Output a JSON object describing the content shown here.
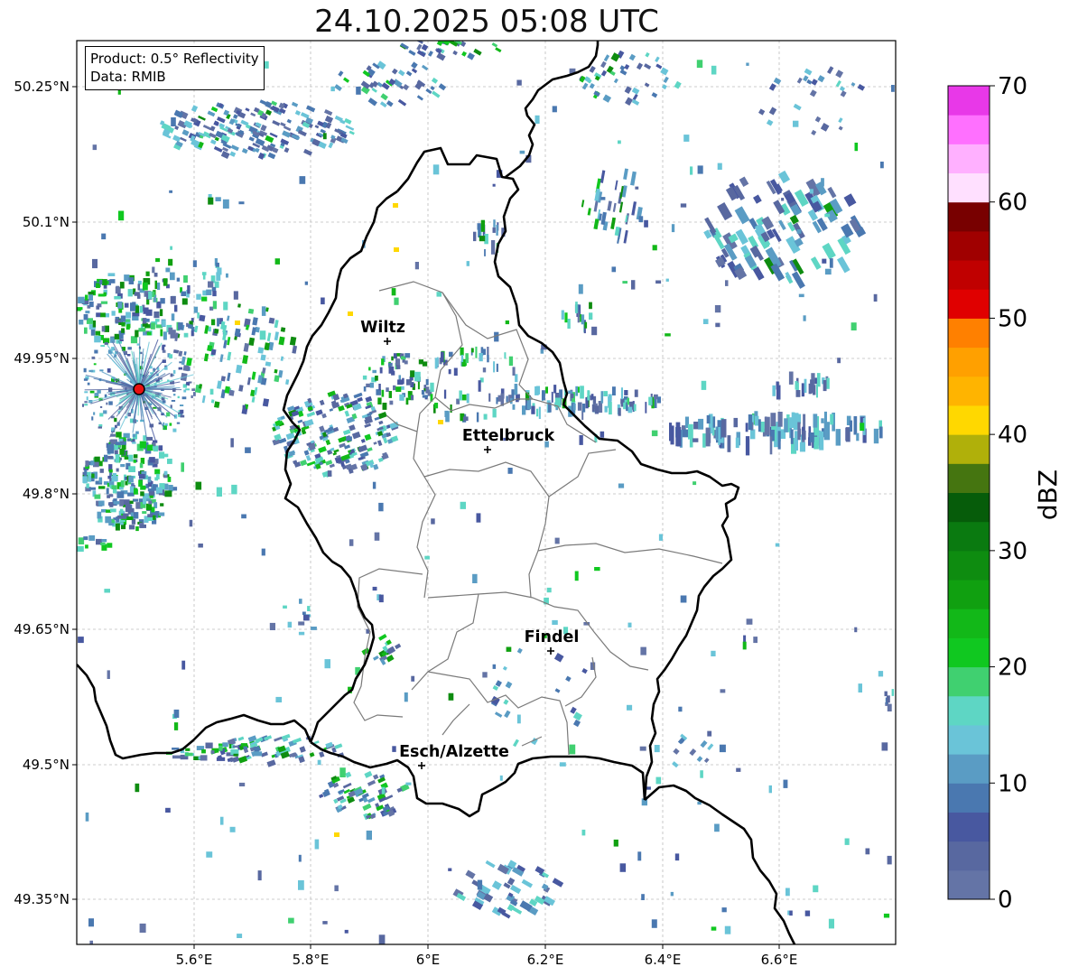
{
  "title": "24.10.2025 05:08 UTC",
  "info": {
    "product": "Product: 0.5° Reflectivity",
    "data": "Data: RMIB"
  },
  "axes": {
    "lon_ticks": [
      "5.6°E",
      "5.8°E",
      "6°E",
      "6.2°E",
      "6.4°E",
      "6.6°E"
    ],
    "lat_ticks": [
      "50.25°N",
      "50.1°N",
      "49.95°N",
      "49.8°N",
      "49.65°N",
      "49.5°N",
      "49.35°N"
    ]
  },
  "cities": [
    {
      "name": "Wiltz"
    },
    {
      "name": "Ettelbruck"
    },
    {
      "name": "Findel"
    },
    {
      "name": "Esch/Alzette"
    }
  ],
  "radar_site": {
    "color": "#e81010"
  },
  "colorbar": {
    "label": "dBZ",
    "ticks": [
      "0",
      "10",
      "20",
      "30",
      "40",
      "50",
      "60",
      "70"
    ],
    "colors": [
      "#6474a6",
      "#5868a0",
      "#4858a0",
      "#4a78b0",
      "#5a9cc4",
      "#6ac4d8",
      "#5ed6c4",
      "#40d070",
      "#10c820",
      "#12b818",
      "#10a010",
      "#0e8c10",
      "#0a7a10",
      "#065c0a",
      "#457510",
      "#b0b00a",
      "#ffd800",
      "#ffb400",
      "#ffa000",
      "#ff8000",
      "#e00000",
      "#c00000",
      "#a00000",
      "#780000",
      "#ffe0ff",
      "#ffb0ff",
      "#ff70ff",
      "#e838e8"
    ]
  }
}
